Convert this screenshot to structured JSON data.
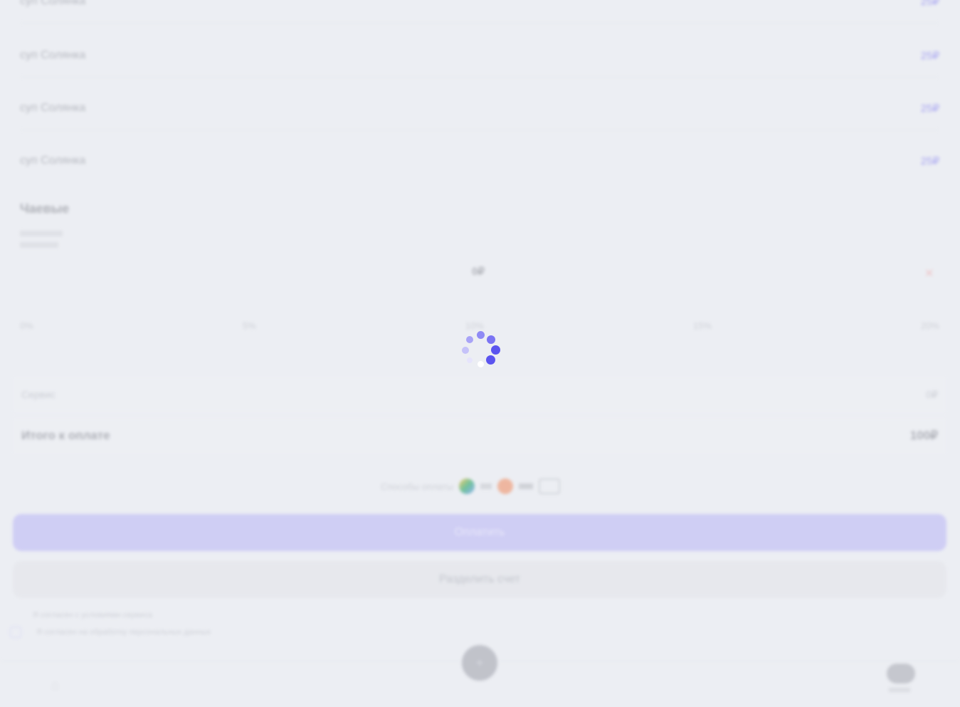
{
  "menu_items": [
    {
      "name": "суп Солянка",
      "price": "25₽"
    },
    {
      "name": "суп Солянка",
      "price": "25₽"
    },
    {
      "name": "суп Солянка",
      "price": "25₽"
    },
    {
      "name": "суп Солянка",
      "price": "25₽"
    }
  ],
  "tips": {
    "title": "Чаевые",
    "current_value": "0₽",
    "close_icon": "close-icon",
    "options": [
      "0%",
      "5%",
      "10%",
      "15%",
      "20%"
    ]
  },
  "summary": {
    "service_label": "Сервис",
    "service_value": "0₽",
    "total_label": "Итого к оплате",
    "total_value": "100₽"
  },
  "payment_methods": {
    "label": "Способы оплаты",
    "logos": [
      "google-pay-icon",
      "mir-icon",
      "card-icon"
    ]
  },
  "buttons": {
    "pay": "Оплатить",
    "split": "Разделить счет"
  },
  "consent_lines": [
    "Я согласен с условиями сервиса",
    "Я согласен на обработку персональных данных"
  ],
  "bottom_nav": {
    "home_icon": "home-icon",
    "center_icon": "plus-icon",
    "profile_icon": "avatar-icon"
  },
  "colors": {
    "accent": "#6a63f0",
    "spinner": "#5b54ef",
    "background": "#eceef3"
  }
}
